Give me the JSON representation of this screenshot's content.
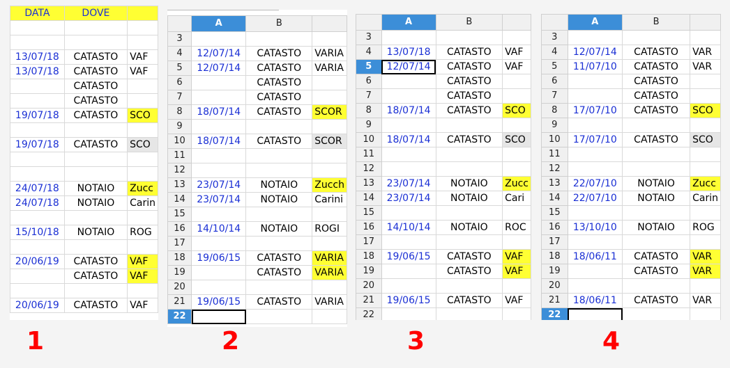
{
  "panel1": {
    "headers": [
      "DATA",
      "DOVE",
      ""
    ],
    "rows": [
      {
        "a": "",
        "b": "",
        "c": ""
      },
      {
        "a": "",
        "b": "",
        "c": ""
      },
      {
        "a": "13/07/18",
        "b": "CATASTO",
        "c": "VAF"
      },
      {
        "a": "13/07/18",
        "b": "CATASTO",
        "c": "VAF"
      },
      {
        "a": "",
        "b": "CATASTO",
        "c": ""
      },
      {
        "a": "",
        "b": "CATASTO",
        "c": ""
      },
      {
        "a": "19/07/18",
        "b": "CATASTO",
        "c": "SCO",
        "hl": true
      },
      {
        "a": "",
        "b": "",
        "c": ""
      },
      {
        "a": "19/07/18",
        "b": "CATASTO",
        "c": "SCO",
        "gr": true
      },
      {
        "a": "",
        "b": "",
        "c": ""
      },
      {
        "a": "",
        "b": "",
        "c": ""
      },
      {
        "a": "24/07/18",
        "b": "NOTAIO",
        "c": "Zucc",
        "hl": true
      },
      {
        "a": "24/07/18",
        "b": "NOTAIO",
        "c": "Carin"
      },
      {
        "a": "",
        "b": "",
        "c": ""
      },
      {
        "a": "15/10/18",
        "b": "NOTAIO",
        "c": "ROG"
      },
      {
        "a": "",
        "b": "",
        "c": ""
      },
      {
        "a": "20/06/19",
        "b": "CATASTO",
        "c": "VAF",
        "hl": true
      },
      {
        "a": "",
        "b": "CATASTO",
        "c": "VAF",
        "hl": true
      },
      {
        "a": "",
        "b": "",
        "c": ""
      },
      {
        "a": "20/06/19",
        "b": "CATASTO",
        "c": "VAF"
      }
    ]
  },
  "panel2": {
    "cols": [
      "A",
      "B",
      ""
    ],
    "rows": [
      {
        "n": "3",
        "a": "",
        "b": "",
        "c": ""
      },
      {
        "n": "4",
        "a": "12/07/14",
        "b": "CATASTO",
        "c": "VARIA"
      },
      {
        "n": "5",
        "a": "12/07/14",
        "b": "CATASTO",
        "c": "VARIA"
      },
      {
        "n": "6",
        "a": "",
        "b": "CATASTO",
        "c": ""
      },
      {
        "n": "7",
        "a": "",
        "b": "CATASTO",
        "c": ""
      },
      {
        "n": "8",
        "a": "18/07/14",
        "b": "CATASTO",
        "c": "SCOR",
        "hl": true
      },
      {
        "n": "9",
        "a": "",
        "b": "",
        "c": ""
      },
      {
        "n": "10",
        "a": "18/07/14",
        "b": "CATASTO",
        "c": "SCOR",
        "gr": true
      },
      {
        "n": "11",
        "a": "",
        "b": "",
        "c": ""
      },
      {
        "n": "12",
        "a": "",
        "b": "",
        "c": ""
      },
      {
        "n": "13",
        "a": "23/07/14",
        "b": "NOTAIO",
        "c": "Zucch",
        "hl": true
      },
      {
        "n": "14",
        "a": "23/07/14",
        "b": "NOTAIO",
        "c": "Carini"
      },
      {
        "n": "15",
        "a": "",
        "b": "",
        "c": ""
      },
      {
        "n": "16",
        "a": "14/10/14",
        "b": "NOTAIO",
        "c": "ROGI"
      },
      {
        "n": "17",
        "a": "",
        "b": "",
        "c": ""
      },
      {
        "n": "18",
        "a": "19/06/15",
        "b": "CATASTO",
        "c": "VARIA",
        "hl": true
      },
      {
        "n": "19",
        "a": "",
        "b": "CATASTO",
        "c": "VARIA",
        "hl": true
      },
      {
        "n": "20",
        "a": "",
        "b": "",
        "c": ""
      },
      {
        "n": "21",
        "a": "19/06/15",
        "b": "CATASTO",
        "c": "VARIA"
      },
      {
        "n": "22",
        "a": "",
        "b": "",
        "c": "",
        "sel": true
      }
    ]
  },
  "panel3": {
    "cols": [
      "A",
      "B",
      ""
    ],
    "rows": [
      {
        "n": "3",
        "a": "",
        "b": "",
        "c": ""
      },
      {
        "n": "4",
        "a": "13/07/18",
        "b": "CATASTO",
        "c": "VAF"
      },
      {
        "n": "5",
        "a": "12/07/14",
        "b": "CATASTO",
        "c": "VAF",
        "sel": true
      },
      {
        "n": "6",
        "a": "",
        "b": "CATASTO",
        "c": ""
      },
      {
        "n": "7",
        "a": "",
        "b": "CATASTO",
        "c": ""
      },
      {
        "n": "8",
        "a": "18/07/14",
        "b": "CATASTO",
        "c": "SCO",
        "hl": true
      },
      {
        "n": "9",
        "a": "",
        "b": "",
        "c": ""
      },
      {
        "n": "10",
        "a": "18/07/14",
        "b": "CATASTO",
        "c": "SCO",
        "gr": true
      },
      {
        "n": "11",
        "a": "",
        "b": "",
        "c": ""
      },
      {
        "n": "12",
        "a": "",
        "b": "",
        "c": ""
      },
      {
        "n": "13",
        "a": "23/07/14",
        "b": "NOTAIO",
        "c": "Zucc",
        "hl": true
      },
      {
        "n": "14",
        "a": "23/07/14",
        "b": "NOTAIO",
        "c": "Cari"
      },
      {
        "n": "15",
        "a": "",
        "b": "",
        "c": ""
      },
      {
        "n": "16",
        "a": "14/10/14",
        "b": "NOTAIO",
        "c": "ROC"
      },
      {
        "n": "17",
        "a": "",
        "b": "",
        "c": ""
      },
      {
        "n": "18",
        "a": "19/06/15",
        "b": "CATASTO",
        "c": "VAF",
        "hl": true
      },
      {
        "n": "19",
        "a": "",
        "b": "CATASTO",
        "c": "VAF",
        "hl": true
      },
      {
        "n": "20",
        "a": "",
        "b": "",
        "c": ""
      },
      {
        "n": "21",
        "a": "19/06/15",
        "b": "CATASTO",
        "c": "VAF"
      },
      {
        "n": "22",
        "a": "",
        "b": "",
        "c": ""
      }
    ]
  },
  "panel4": {
    "cols": [
      "A",
      "B",
      ""
    ],
    "rows": [
      {
        "n": "3",
        "a": "",
        "b": "",
        "c": ""
      },
      {
        "n": "4",
        "a": "12/07/14",
        "b": "CATASTO",
        "c": "VAR"
      },
      {
        "n": "5",
        "a": "11/07/10",
        "b": "CATASTO",
        "c": "VAR"
      },
      {
        "n": "6",
        "a": "",
        "b": "CATASTO",
        "c": ""
      },
      {
        "n": "7",
        "a": "",
        "b": "CATASTO",
        "c": ""
      },
      {
        "n": "8",
        "a": "17/07/10",
        "b": "CATASTO",
        "c": "SCO",
        "hl": true
      },
      {
        "n": "9",
        "a": "",
        "b": "",
        "c": ""
      },
      {
        "n": "10",
        "a": "17/07/10",
        "b": "CATASTO",
        "c": "SCO",
        "gr": true
      },
      {
        "n": "11",
        "a": "",
        "b": "",
        "c": ""
      },
      {
        "n": "12",
        "a": "",
        "b": "",
        "c": ""
      },
      {
        "n": "13",
        "a": "22/07/10",
        "b": "NOTAIO",
        "c": "Zucc",
        "hl": true
      },
      {
        "n": "14",
        "a": "22/07/10",
        "b": "NOTAIO",
        "c": "Carin"
      },
      {
        "n": "15",
        "a": "",
        "b": "",
        "c": ""
      },
      {
        "n": "16",
        "a": "13/10/10",
        "b": "NOTAIO",
        "c": "ROG"
      },
      {
        "n": "17",
        "a": "",
        "b": "",
        "c": ""
      },
      {
        "n": "18",
        "a": "18/06/11",
        "b": "CATASTO",
        "c": "VAR",
        "hl": true
      },
      {
        "n": "19",
        "a": "",
        "b": "CATASTO",
        "c": "VAR",
        "hl": true
      },
      {
        "n": "20",
        "a": "",
        "b": "",
        "c": ""
      },
      {
        "n": "21",
        "a": "18/06/11",
        "b": "CATASTO",
        "c": "VAR"
      },
      {
        "n": "22",
        "a": "",
        "b": "",
        "c": "",
        "sel": true
      }
    ]
  },
  "labels": [
    "1",
    "2",
    "3",
    "4"
  ],
  "colors": {
    "date": "#1a2fd4",
    "highlight": "#ffff33",
    "gray": "#e6e6e6",
    "selected": "#3c8ed8",
    "label": "#ff0000"
  }
}
